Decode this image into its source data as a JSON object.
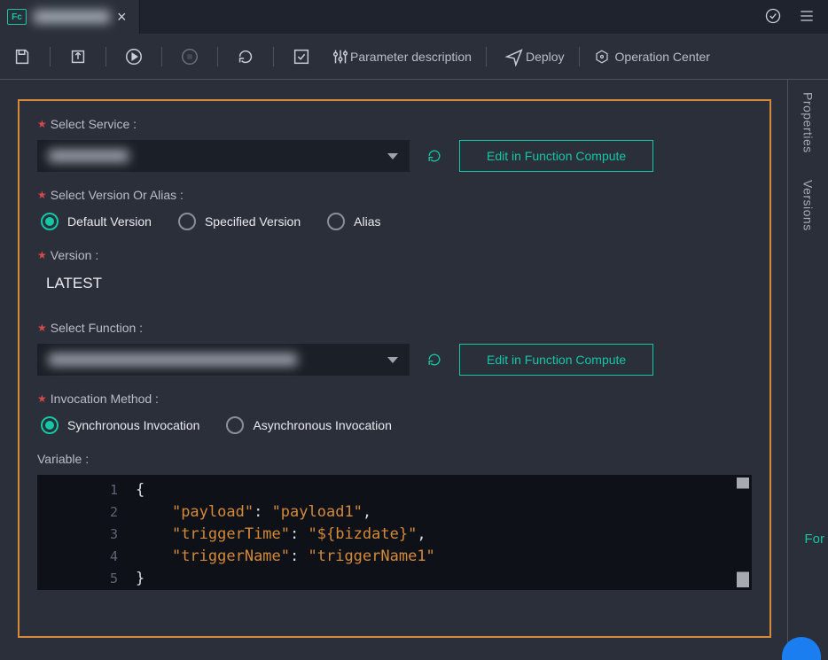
{
  "tab": {
    "badge": "Fc",
    "close": "×"
  },
  "toolbar": {
    "param_desc": "Parameter description",
    "deploy": "Deploy",
    "op_center": "Operation Center"
  },
  "sidepanel": {
    "properties": "Properties",
    "versions": "Versions"
  },
  "form": {
    "select_service_label": "Select Service :",
    "edit_fc": "Edit in Function Compute",
    "select_version_or_alias_label": "Select Version Or Alias :",
    "radio_version": {
      "default": "Default Version",
      "specified": "Specified Version",
      "alias": "Alias"
    },
    "version_label": "Version :",
    "version_value": "LATEST",
    "select_function_label": "Select Function :",
    "invocation_label": "Invocation Method :",
    "invocation_sync": "Synchronous Invocation",
    "invocation_async": "Asynchronous Invocation",
    "variable_label": "Variable :"
  },
  "editor": {
    "lines": [
      "1",
      "2",
      "3",
      "4",
      "5"
    ],
    "kv": {
      "k1": "\"payload\"",
      "v1": "\"payload1\"",
      "k2": "\"triggerTime\"",
      "v2": "\"${bizdate}\"",
      "k3": "\"triggerName\"",
      "v3": "\"triggerName1\""
    }
  },
  "hints": {
    "for": "For"
  }
}
